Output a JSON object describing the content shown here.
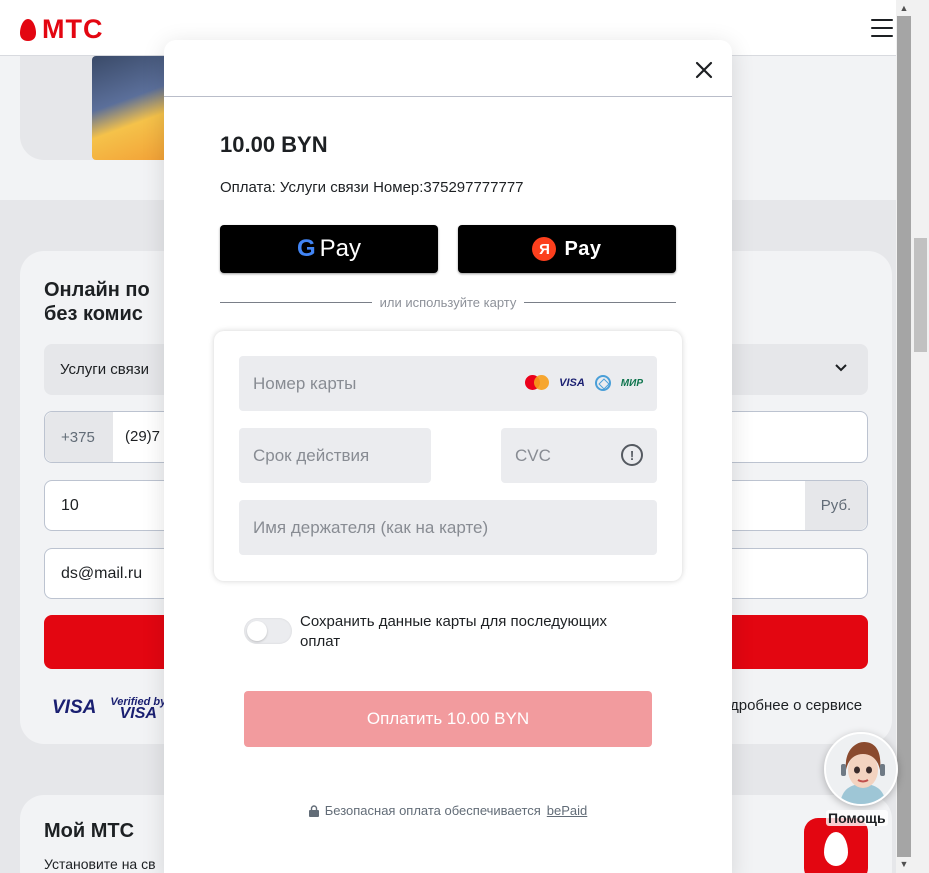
{
  "header": {
    "logo_text": "МТС"
  },
  "background": {
    "pay_title": "Онлайн по\nбез комис",
    "service_select": "Услуги связи",
    "phone_prefix": "+375",
    "phone_value": "(29)7",
    "sum_value": "10",
    "currency_suffix": "Руб.",
    "email_value": "ds@mail.ru",
    "visa_label": "VISA",
    "verified_by": "Verified by",
    "verified_visa": "VISA",
    "more_link": "дробнее о сервисе",
    "my_mts_title": "Мой МТС",
    "my_mts_sub": "Установите на св"
  },
  "assistant": {
    "label": "Помощь"
  },
  "modal": {
    "amount": "10.00 BYN",
    "description": "Оплата: Услуги связи Номер:375297777777",
    "gpay_label": "Pay",
    "gpay_g": "G",
    "ypay_badge": "Я",
    "ypay_label": "Pay",
    "divider_text": "или используйте карту",
    "card_number_placeholder": "Номер карты",
    "expiry_placeholder": "Срок действия",
    "cvc_placeholder": "CVC",
    "holder_placeholder": "Имя держателя (как на карте)",
    "card_brand_visa": "VISA",
    "card_brand_mir": "МИР",
    "info_glyph": "!",
    "save_card_text": "Сохранить данные карты для последующих оплат",
    "pay_button": "Оплатить 10.00 BYN",
    "secure_text": "Безопасная оплата обеспечивается",
    "secure_link": "bePaid"
  },
  "scrollbar": {
    "up": "▲",
    "down": "▼"
  },
  "colors": {
    "brand_red": "#e30611",
    "pay_button_disabled": "#f29b9e",
    "yandex_red": "#fc3f1d"
  }
}
